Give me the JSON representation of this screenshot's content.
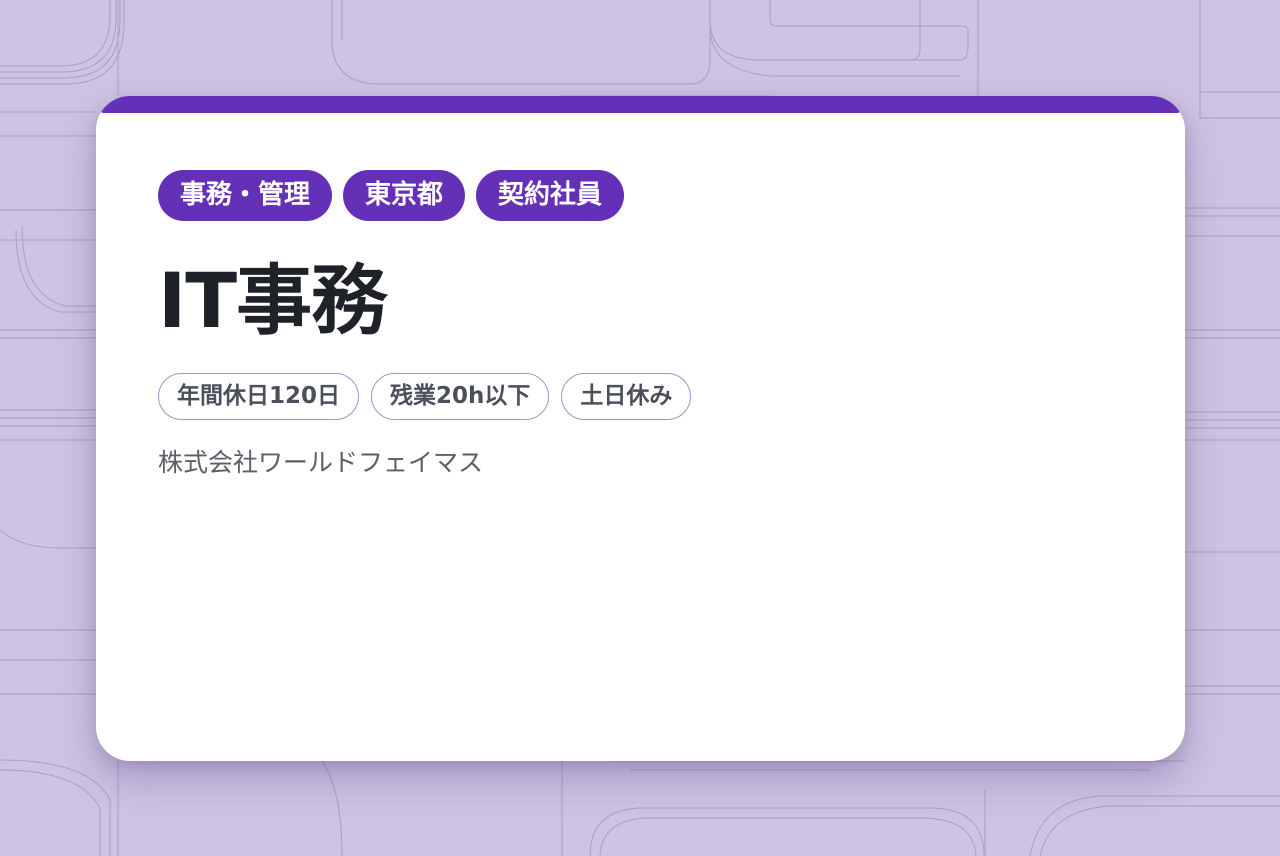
{
  "job": {
    "category_tags": [
      "事務・管理",
      "東京都",
      "契約社員"
    ],
    "title": "IT事務",
    "feature_tags": [
      "年間休日120日",
      "残業20h以下",
      "土日休み"
    ],
    "company": "株式会社ワールドフェイマス"
  },
  "colors": {
    "background": "#cdc3e3",
    "accent": "#6430b8",
    "feature_border": "#a98fd0",
    "title": "#1f2229",
    "company": "#5b5f6a"
  }
}
